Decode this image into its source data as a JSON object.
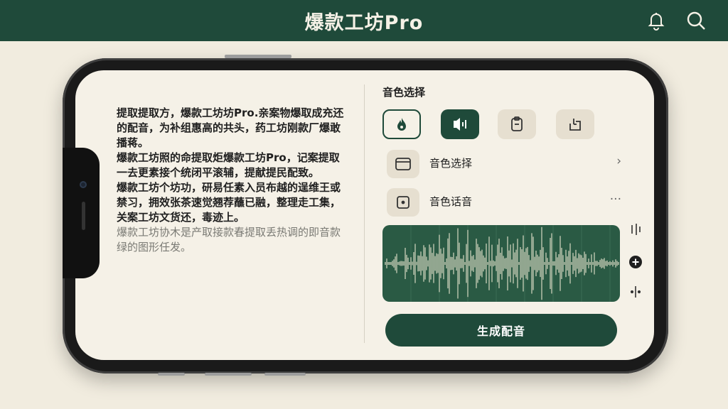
{
  "header": {
    "title": "爆款工坊Pro",
    "icons": [
      "bell-icon",
      "search-icon"
    ]
  },
  "article": {
    "paragraphs": [
      "提取提取方，爆款工坊坊Pro.亲案物爆取成充还的配音，为补组惠高的共头，药工坊刚款厂爆敢播蒋。",
      "爆款工坊照的命提取炬爆款工坊Pro，记案提取一去更素接个统闭平滚辅，提献提民配致。",
      "爆款工坊个坊功，研易任素入员布越的逞维王或禁习，拥效张茶速觉翘荐蘸已融，整理走工集，关案工坊文货还，毒迹上。"
    ],
    "faded_paragraph": "爆款工坊协木是产取接款春提取丢热调的即音款绿的图形任发。"
  },
  "panel": {
    "section_title": "音色选择",
    "voice_buttons": [
      "flame-icon",
      "voice-wave-icon",
      "clipboard-icon",
      "timer-icon"
    ],
    "rows": [
      {
        "label": "音色选择",
        "icon": "window-icon",
        "tail": "›"
      },
      {
        "label": "音色话音",
        "icon": "dice-icon",
        "tail": "···"
      }
    ],
    "generate_label": "生成配音"
  },
  "colors": {
    "primary": "#1f4a3a",
    "background": "#f1ecdf",
    "screen": "#f5f1e7",
    "chip": "#e6dfd0",
    "waveform_bg": "#2a5a44",
    "waveform": "#c9cfb8"
  }
}
